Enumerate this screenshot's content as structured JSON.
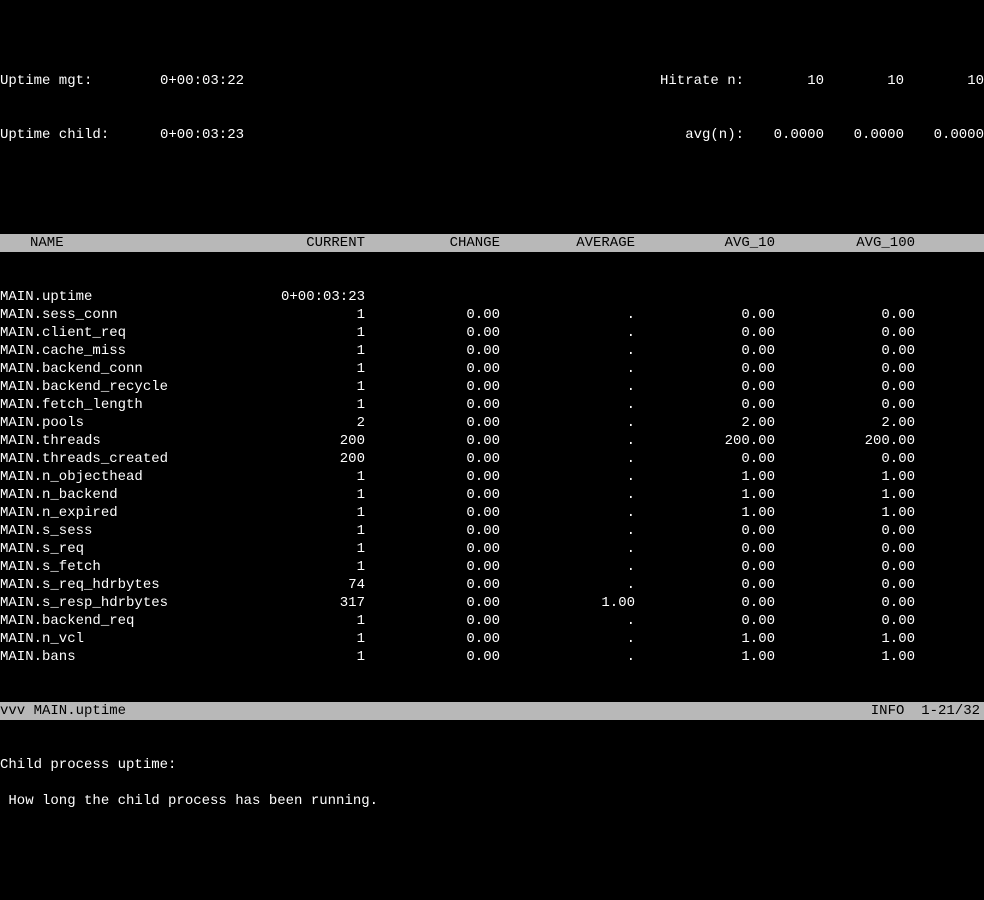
{
  "top": {
    "uptime_mgt_label": "Uptime mgt:",
    "uptime_mgt_value": "0+00:03:22",
    "uptime_child_label": "Uptime child:",
    "uptime_child_value": "0+00:03:23",
    "hitrate_n_label": "Hitrate n:",
    "hitrate_n_1": "10",
    "hitrate_n_2": "10",
    "hitrate_n_3": "10",
    "avg_n_label": "avg(n):",
    "avg_n_1": "0.0000",
    "avg_n_2": "0.0000",
    "avg_n_3": "0.0000"
  },
  "columns": {
    "name": "NAME",
    "current": "CURRENT",
    "change": "CHANGE",
    "average": "AVERAGE",
    "avg_10": "AVG_10",
    "avg_100": "AVG_100"
  },
  "rows": [
    {
      "name": "MAIN.uptime",
      "current": "0+00:03:23",
      "change": "",
      "average": "",
      "avg_10": "",
      "avg_100": ""
    },
    {
      "name": "MAIN.sess_conn",
      "current": "1",
      "change": "0.00",
      "average": ".",
      "avg_10": "0.00",
      "avg_100": "0.00"
    },
    {
      "name": "MAIN.client_req",
      "current": "1",
      "change": "0.00",
      "average": ".",
      "avg_10": "0.00",
      "avg_100": "0.00"
    },
    {
      "name": "MAIN.cache_miss",
      "current": "1",
      "change": "0.00",
      "average": ".",
      "avg_10": "0.00",
      "avg_100": "0.00"
    },
    {
      "name": "MAIN.backend_conn",
      "current": "1",
      "change": "0.00",
      "average": ".",
      "avg_10": "0.00",
      "avg_100": "0.00"
    },
    {
      "name": "MAIN.backend_recycle",
      "current": "1",
      "change": "0.00",
      "average": ".",
      "avg_10": "0.00",
      "avg_100": "0.00"
    },
    {
      "name": "MAIN.fetch_length",
      "current": "1",
      "change": "0.00",
      "average": ".",
      "avg_10": "0.00",
      "avg_100": "0.00"
    },
    {
      "name": "MAIN.pools",
      "current": "2",
      "change": "0.00",
      "average": ".",
      "avg_10": "2.00",
      "avg_100": "2.00"
    },
    {
      "name": "MAIN.threads",
      "current": "200",
      "change": "0.00",
      "average": ".",
      "avg_10": "200.00",
      "avg_100": "200.00"
    },
    {
      "name": "MAIN.threads_created",
      "current": "200",
      "change": "0.00",
      "average": ".",
      "avg_10": "0.00",
      "avg_100": "0.00"
    },
    {
      "name": "MAIN.n_objecthead",
      "current": "1",
      "change": "0.00",
      "average": ".",
      "avg_10": "1.00",
      "avg_100": "1.00"
    },
    {
      "name": "MAIN.n_backend",
      "current": "1",
      "change": "0.00",
      "average": ".",
      "avg_10": "1.00",
      "avg_100": "1.00"
    },
    {
      "name": "MAIN.n_expired",
      "current": "1",
      "change": "0.00",
      "average": ".",
      "avg_10": "1.00",
      "avg_100": "1.00"
    },
    {
      "name": "MAIN.s_sess",
      "current": "1",
      "change": "0.00",
      "average": ".",
      "avg_10": "0.00",
      "avg_100": "0.00"
    },
    {
      "name": "MAIN.s_req",
      "current": "1",
      "change": "0.00",
      "average": ".",
      "avg_10": "0.00",
      "avg_100": "0.00"
    },
    {
      "name": "MAIN.s_fetch",
      "current": "1",
      "change": "0.00",
      "average": ".",
      "avg_10": "0.00",
      "avg_100": "0.00"
    },
    {
      "name": "MAIN.s_req_hdrbytes",
      "current": "74",
      "change": "0.00",
      "average": ".",
      "avg_10": "0.00",
      "avg_100": "0.00"
    },
    {
      "name": "MAIN.s_resp_hdrbytes",
      "current": "317",
      "change": "0.00",
      "average": "1.00",
      "avg_10": "0.00",
      "avg_100": "0.00"
    },
    {
      "name": "MAIN.backend_req",
      "current": "1",
      "change": "0.00",
      "average": ".",
      "avg_10": "0.00",
      "avg_100": "0.00"
    },
    {
      "name": "MAIN.n_vcl",
      "current": "1",
      "change": "0.00",
      "average": ".",
      "avg_10": "1.00",
      "avg_100": "1.00"
    },
    {
      "name": "MAIN.bans",
      "current": "1",
      "change": "0.00",
      "average": ".",
      "avg_10": "1.00",
      "avg_100": "1.00"
    }
  ],
  "status": {
    "selection": "vvv MAIN.uptime",
    "info_label": "INFO",
    "position": "1-21/32"
  },
  "desc": {
    "title": "Child process uptime:",
    "body": " How long the child process has been running."
  }
}
